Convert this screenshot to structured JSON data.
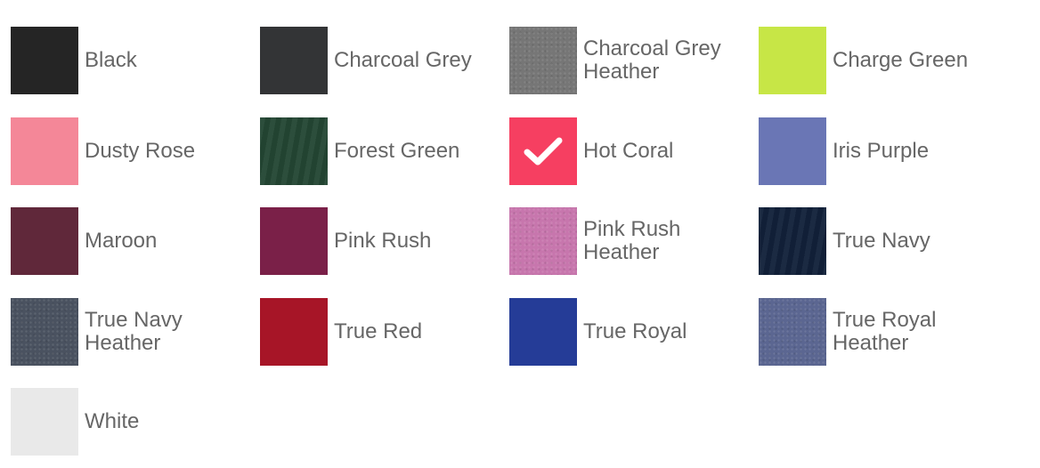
{
  "colors": [
    {
      "label": "Black",
      "hex": "#252525",
      "texture": "solid"
    },
    {
      "label": "Charcoal Grey",
      "hex": "#333436",
      "texture": "solid"
    },
    {
      "label": "Charcoal Grey Heather",
      "hex": "#767676",
      "texture": "heather"
    },
    {
      "label": "Charge Green",
      "hex": "#c7e646",
      "texture": "solid"
    },
    {
      "label": "Dusty Rose",
      "hex": "#f48798",
      "texture": "solid"
    },
    {
      "label": "Forest Green",
      "hex": "#244734",
      "texture": "fabric"
    },
    {
      "label": "Hot Coral",
      "hex": "#f63f61",
      "texture": "solid",
      "selected": true,
      "icon": "check-icon"
    },
    {
      "label": "Iris Purple",
      "hex": "#6a76b5",
      "texture": "solid"
    },
    {
      "label": "Maroon",
      "hex": "#60283a",
      "texture": "solid"
    },
    {
      "label": "Pink Rush",
      "hex": "#7a2048",
      "texture": "solid"
    },
    {
      "label": "Pink Rush Heather",
      "hex": "#c776ad",
      "texture": "heather"
    },
    {
      "label": "True Navy",
      "hex": "#12213a",
      "texture": "fabric"
    },
    {
      "label": "True Navy Heather",
      "hex": "#4a5260",
      "texture": "heather"
    },
    {
      "label": "True Red",
      "hex": "#a71527",
      "texture": "solid"
    },
    {
      "label": "True Royal",
      "hex": "#253c97",
      "texture": "solid"
    },
    {
      "label": "True Royal Heather",
      "hex": "#5b6691",
      "texture": "heather"
    },
    {
      "label": "White",
      "hex": "#e9e9e9",
      "texture": "solid"
    }
  ]
}
